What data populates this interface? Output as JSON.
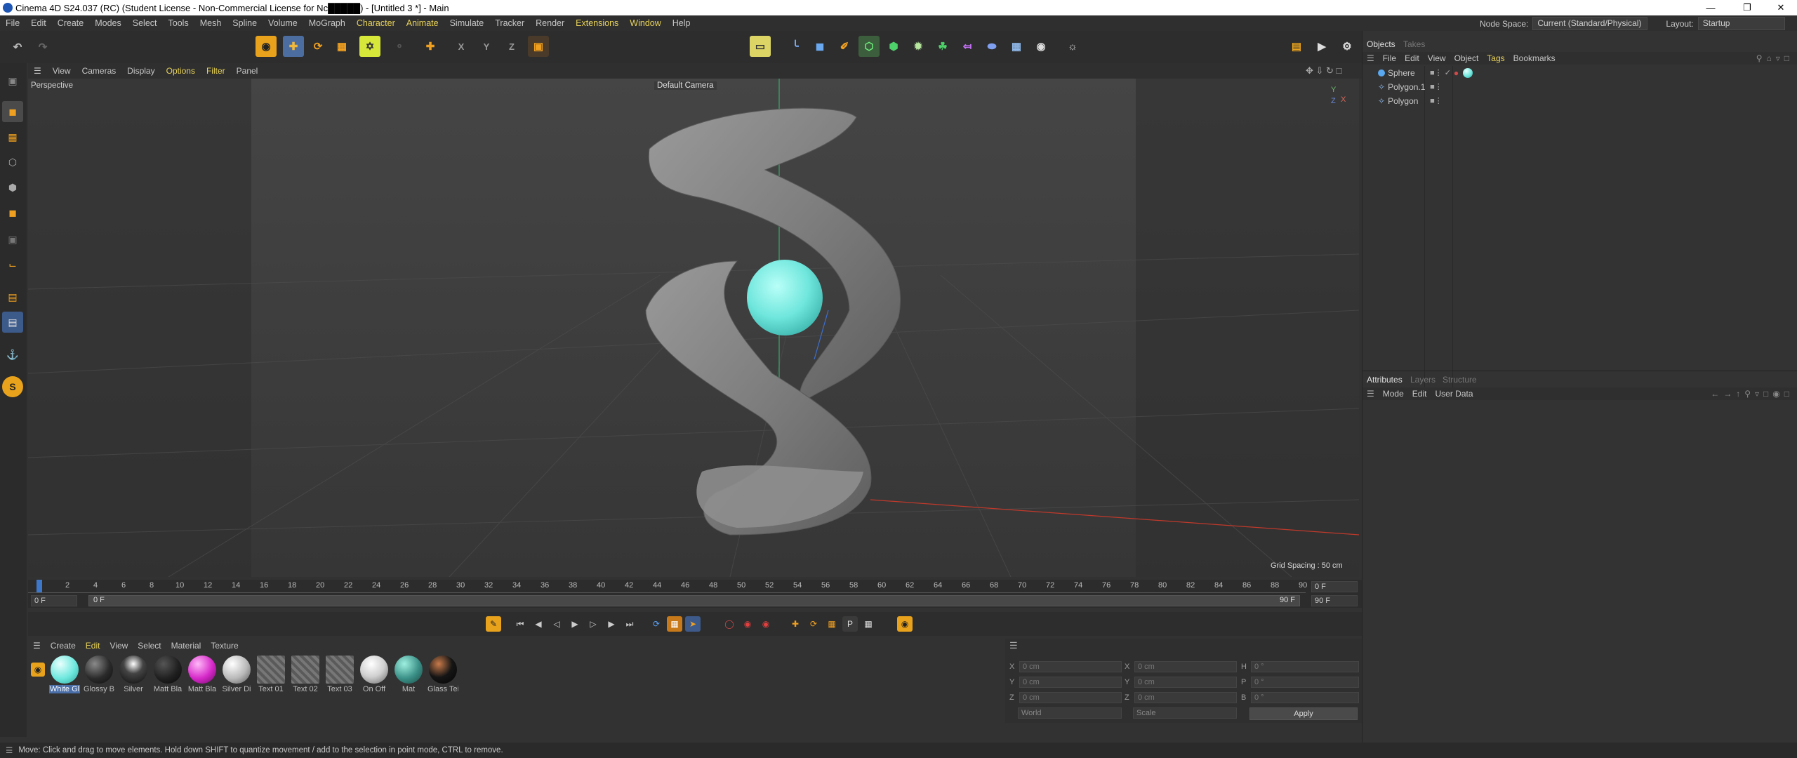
{
  "window": {
    "title": "Cinema 4D S24.037 (RC) (Student License - Non-Commercial License for Nc█████) - [Untitled 3 *] - Main",
    "controls": {
      "minimize": "—",
      "restore": "❐",
      "close": "✕"
    }
  },
  "menubar": {
    "items": [
      "File",
      "Edit",
      "Create",
      "Modes",
      "Select",
      "Tools",
      "Mesh",
      "Spline",
      "Volume",
      "MoGraph",
      "Character",
      "Animate",
      "Simulate",
      "Tracker",
      "Render",
      "Extensions",
      "Window",
      "Help"
    ],
    "node_space_label": "Node Space:",
    "node_space_value": "Current (Standard/Physical)",
    "layout_label": "Layout:",
    "layout_value": "Startup"
  },
  "toolbar": {
    "axis_x": "X",
    "axis_y": "Y",
    "axis_z": "Z"
  },
  "viewport": {
    "menu": [
      "View",
      "Cameras",
      "Display",
      "Options",
      "Filter",
      "Panel"
    ],
    "label": "Perspective",
    "camera": "Default Camera",
    "grid_spacing": "Grid Spacing : 50 cm",
    "axis_y": "Y",
    "axis_x": "X",
    "axis_z": "Z"
  },
  "timeline": {
    "ticks": [
      "0",
      "2",
      "4",
      "6",
      "8",
      "10",
      "12",
      "14",
      "16",
      "18",
      "20",
      "22",
      "24",
      "26",
      "28",
      "30",
      "32",
      "34",
      "36",
      "38",
      "40",
      "42",
      "44",
      "46",
      "48",
      "50",
      "52",
      "54",
      "56",
      "58",
      "60",
      "62",
      "64",
      "66",
      "68",
      "70",
      "72",
      "74",
      "76",
      "78",
      "80",
      "82",
      "84",
      "86",
      "88",
      "90"
    ],
    "current_frame": "0 F",
    "start_frame": "0 F",
    "range_start": "0 F",
    "range_end": "90 F",
    "end_frame": "90 F"
  },
  "materials": {
    "menu": [
      "Create",
      "Edit",
      "View",
      "Select",
      "Material",
      "Texture"
    ],
    "items": [
      {
        "label": "White Gl",
        "color": "#6ee8de",
        "selected": true
      },
      {
        "label": "Glossy B",
        "color": "#2a2a2a"
      },
      {
        "label": "Silver",
        "color": "#1a1a1a"
      },
      {
        "label": "Matt Bla",
        "color": "#202020"
      },
      {
        "label": "Matt Bla",
        "color": "#d528c8"
      },
      {
        "label": "Silver Di",
        "color": "#b8b8b8"
      },
      {
        "label": "Text 01",
        "color": "#6a6a6a"
      },
      {
        "label": "Text 02",
        "color": "#6a6a6a"
      },
      {
        "label": "Text 03",
        "color": "#6a6a6a"
      },
      {
        "label": "On Off",
        "color": "#cfcfcf"
      },
      {
        "label": "Mat",
        "color": "#3a8f86"
      },
      {
        "label": "Glass Tei",
        "color": "#151515"
      }
    ]
  },
  "coords": {
    "col1": [
      {
        "axis": "X",
        "value": "0 cm"
      },
      {
        "axis": "Y",
        "value": "0 cm"
      },
      {
        "axis": "Z",
        "value": "0 cm"
      }
    ],
    "col2": [
      {
        "axis": "X",
        "value": "0 cm"
      },
      {
        "axis": "Y",
        "value": "0 cm"
      },
      {
        "axis": "Z",
        "value": "0 cm"
      }
    ],
    "col3": [
      {
        "axis": "H",
        "value": "0 °"
      },
      {
        "axis": "P",
        "value": "0 °"
      },
      {
        "axis": "B",
        "value": "0 °"
      }
    ],
    "mode_world": "World",
    "mode_scale": "Scale",
    "apply": "Apply"
  },
  "objects_panel": {
    "tabs": [
      "Objects",
      "Takes"
    ],
    "menu": [
      "File",
      "Edit",
      "View",
      "Object",
      "Tags",
      "Bookmarks"
    ],
    "rows": [
      {
        "name": "Sphere",
        "icon": "sphere-icon"
      },
      {
        "name": "Polygon.1",
        "icon": "polygon-icon"
      },
      {
        "name": "Polygon",
        "icon": "polygon-icon"
      }
    ]
  },
  "attributes_panel": {
    "tabs": [
      "Attributes",
      "Layers",
      "Structure"
    ],
    "menu": [
      "Mode",
      "Edit",
      "User Data"
    ]
  },
  "status": "Move: Click and drag to move elements. Hold down SHIFT to quantize movement / add to the selection in point mode, CTRL to remove."
}
